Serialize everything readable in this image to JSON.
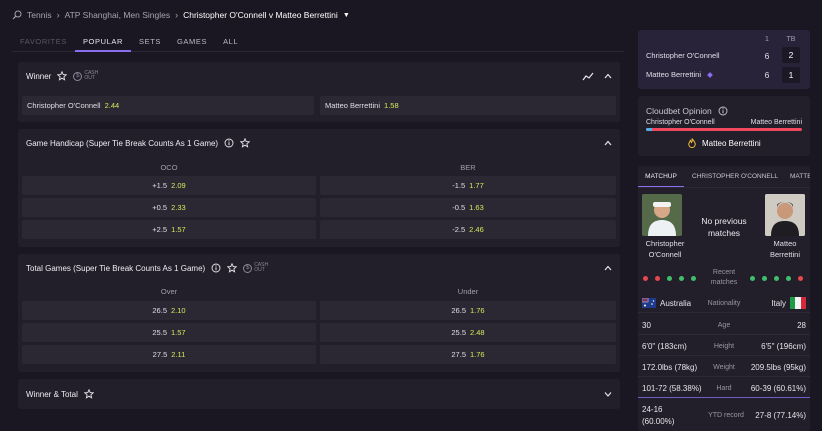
{
  "breadcrumb": {
    "sport": "Tennis",
    "competition": "ATP Shanghai, Men Singles",
    "event": "Christopher O'Connell v Matteo Berrettini"
  },
  "tabs": [
    "FAVORITES",
    "POPULAR",
    "SETS",
    "GAMES",
    "ALL"
  ],
  "cashout_label": [
    "CASH",
    "OUT"
  ],
  "markets": {
    "winner": {
      "title": "Winner",
      "home": {
        "name": "Christopher O'Connell",
        "odd": "2.44"
      },
      "away": {
        "name": "Matteo Berrettini",
        "odd": "1.58"
      }
    },
    "handicap": {
      "title": "Game Handicap (Super Tie Break Counts As 1 Game)",
      "col_left": "OCO",
      "col_right": "BER",
      "rows": [
        {
          "l_line": "+1.5",
          "l_odd": "2.09",
          "r_line": "-1.5",
          "r_odd": "1.77"
        },
        {
          "l_line": "+0.5",
          "l_odd": "2.33",
          "r_line": "-0.5",
          "r_odd": "1.63"
        },
        {
          "l_line": "+2.5",
          "l_odd": "1.57",
          "r_line": "-2.5",
          "r_odd": "2.46"
        }
      ]
    },
    "total": {
      "title": "Total Games (Super Tie Break Counts As 1 Game)",
      "col_left": "Over",
      "col_right": "Under",
      "rows": [
        {
          "l_line": "26.5",
          "l_odd": "2.10",
          "r_line": "26.5",
          "r_odd": "1.76"
        },
        {
          "l_line": "25.5",
          "l_odd": "1.57",
          "r_line": "25.5",
          "r_odd": "2.48"
        },
        {
          "l_line": "27.5",
          "l_odd": "2.11",
          "r_line": "27.5",
          "r_odd": "1.76"
        }
      ]
    },
    "winner_total": {
      "title": "Winner & Total"
    }
  },
  "scoreboard": {
    "col1": "1",
    "col2": "TB",
    "p1": {
      "name": "Christopher O'Connell",
      "s1": "6",
      "tb": "2"
    },
    "p2": {
      "name": "Matteo Berrettini",
      "s1": "6",
      "tb": "1"
    }
  },
  "opinion": {
    "title": "Cloudbet Opinion",
    "left": "Christopher O'Connell",
    "right": "Matteo Berrettini",
    "left_share": 0.04,
    "pick": "Matteo Berrettini"
  },
  "stats": {
    "tabs": [
      "MATCHUP",
      "CHRISTOPHER O'CONNELL",
      "MATTE"
    ],
    "p1_name": [
      "Christopher",
      "O'Connell"
    ],
    "p2_name": [
      "Matteo",
      "Berrettini"
    ],
    "center": "No previous matches",
    "recent_label": [
      "Recent",
      "matches"
    ],
    "p1_recent": [
      "red",
      "red",
      "green",
      "green",
      "green"
    ],
    "p2_recent": [
      "green",
      "green",
      "green",
      "green",
      "red"
    ],
    "nationality": {
      "left": "Australia",
      "label": "Nationality",
      "right": "Italy"
    },
    "rows": [
      {
        "left": "30",
        "label": "Age",
        "right": "28"
      },
      {
        "left": "6'0\" (183cm)",
        "label": "Height",
        "right": "6'5\" (196cm)"
      },
      {
        "left": "172.0lbs (78kg)",
        "label": "Weight",
        "right": "209.5lbs (95kg)"
      },
      {
        "left": "101-72 (58.38%)",
        "label": "Hard",
        "right": "60-39 (60.61%)"
      }
    ],
    "ytd": {
      "left": [
        "24-16",
        "(60.00%)"
      ],
      "label": "YTD record",
      "right": "27-8 (77.14%)"
    }
  },
  "colors": {
    "accent": "#8b6ef0",
    "odd": "#d8ea5c",
    "win": "#3fbf6a",
    "loss": "#e5484d",
    "opinion_left": "#4fb0e8",
    "opinion_right": "#f0485c"
  }
}
